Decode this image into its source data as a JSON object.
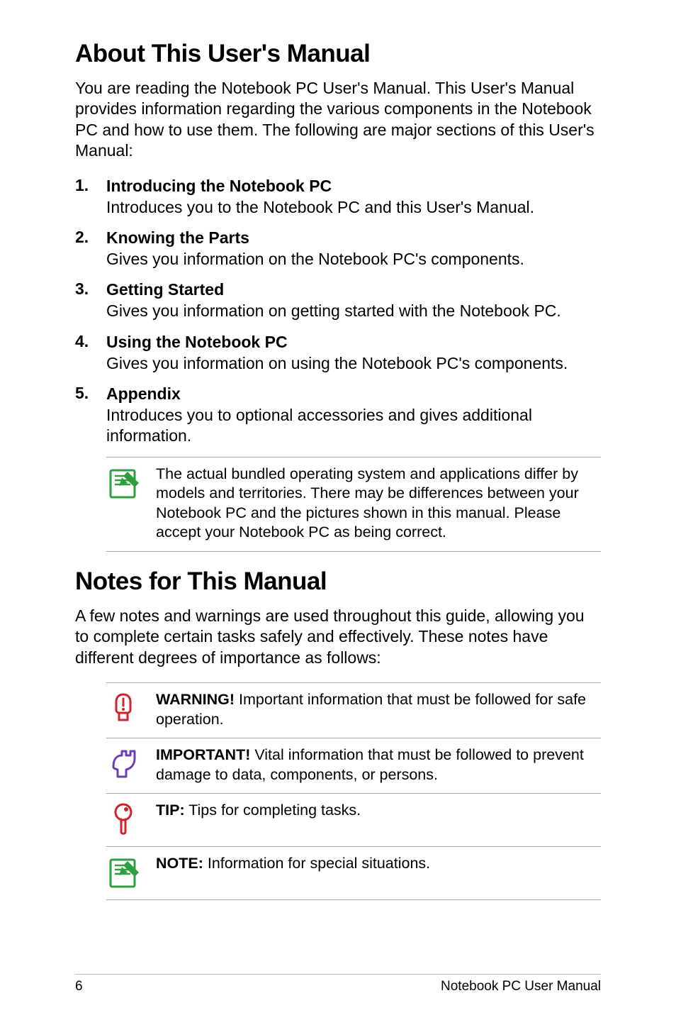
{
  "heading1": "About This User's Manual",
  "intro": "You are reading the Notebook PC User's Manual. This User's Manual provides information regarding the various components in the Notebook PC and how to use them. The following are major sections of this User's Manual:",
  "sections": [
    {
      "title": "Introducing the Notebook PC",
      "desc": "Introduces you to the Notebook PC and this User's Manual."
    },
    {
      "title": "Knowing the Parts",
      "desc": "Gives you information on the Notebook PC's components."
    },
    {
      "title": "Getting Started",
      "desc": "Gives you information on getting started with the Notebook PC."
    },
    {
      "title": "Using the Notebook PC",
      "desc": "Gives you information on using the Notebook PC's components."
    },
    {
      "title": "Appendix",
      "desc": "Introduces you to optional accessories and gives additional information."
    }
  ],
  "note_box": {
    "text": "The actual bundled operating system and applications differ by models and territories. There may be differences between your Notebook PC and the pictures shown in this manual. Please accept your Notebook PC as being correct."
  },
  "heading2": "Notes for This Manual",
  "notes_intro": "A few notes and warnings are used throughout this guide, allowing you to complete certain tasks safely and effectively. These notes have different degrees of importance as follows:",
  "callouts": [
    {
      "label": "WARNING!",
      "text": " Important information that must be followed for safe operation.",
      "icon": "warning-icon"
    },
    {
      "label": "IMPORTANT!",
      "text": " Vital information that must be followed to prevent damage to data, components, or persons.",
      "icon": "important-icon"
    },
    {
      "label": "TIP:",
      "text": " Tips for completing tasks.",
      "icon": "tip-icon"
    },
    {
      "label": "NOTE:",
      "text": "  Information for special situations.",
      "icon": "note-icon"
    }
  ],
  "footer": {
    "page": "6",
    "title": "Notebook PC User Manual"
  }
}
